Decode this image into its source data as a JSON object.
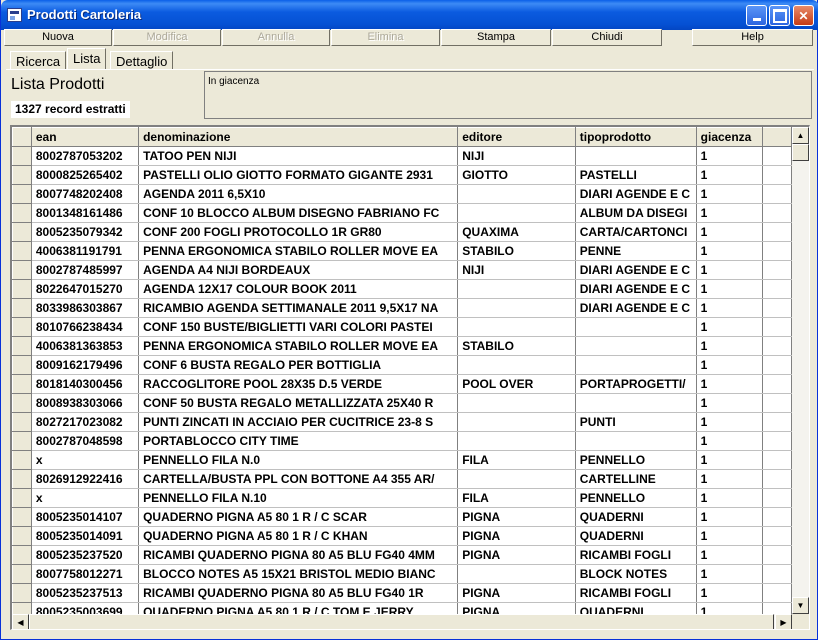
{
  "window": {
    "title": "Prodotti Cartoleria"
  },
  "toolbar": {
    "buttons": [
      {
        "label": "Nuova",
        "enabled": true
      },
      {
        "label": "Modifica",
        "enabled": false
      },
      {
        "label": "Annulla",
        "enabled": false
      },
      {
        "label": "Elimina",
        "enabled": false
      },
      {
        "label": "Stampa",
        "enabled": true
      },
      {
        "label": "Chiudi",
        "enabled": true
      },
      {
        "label": "Help",
        "enabled": true
      }
    ]
  },
  "tabs": [
    {
      "label": "Ricerca",
      "active": false
    },
    {
      "label": "Lista",
      "active": true
    },
    {
      "label": "Dettaglio",
      "active": false
    }
  ],
  "panel": {
    "title": "Lista Prodotti",
    "record_count": "1327 record estratti",
    "filter_text": "In giacenza"
  },
  "grid": {
    "columns": [
      "ean",
      "denominazione",
      "editore",
      "tipoprodotto",
      "giacenza"
    ],
    "rows": [
      [
        "8002787053202",
        "TATOO PEN NIJI",
        "NIJI",
        "",
        "1"
      ],
      [
        "8000825265402",
        "PASTELLI OLIO GIOTTO FORMATO GIGANTE 2931",
        "GIOTTO",
        "PASTELLI",
        "1"
      ],
      [
        "8007748202408",
        "AGENDA 2011 6,5X10",
        "",
        "DIARI AGENDE E C",
        "1"
      ],
      [
        "8001348161486",
        "CONF 10 BLOCCO ALBUM DISEGNO FABRIANO FC",
        "",
        "ALBUM DA DISEGI",
        "1"
      ],
      [
        "8005235079342",
        "CONF 200 FOGLI PROTOCOLLO 1R GR80",
        "QUAXIMA",
        "CARTA/CARTONCI",
        "1"
      ],
      [
        "4006381191791",
        "PENNA ERGONOMICA STABILO ROLLER MOVE EA",
        "STABILO",
        "PENNE",
        "1"
      ],
      [
        "8002787485997",
        "AGENDA A4 NIJI BORDEAUX",
        "NIJI",
        "DIARI AGENDE E C",
        "1"
      ],
      [
        "8022647015270",
        "AGENDA 12X17 COLOUR BOOK 2011",
        "",
        "DIARI AGENDE E C",
        "1"
      ],
      [
        "8033986303867",
        "RICAMBIO AGENDA SETTIMANALE 2011 9,5X17 NA",
        "",
        "DIARI AGENDE E C",
        "1"
      ],
      [
        "8010766238434",
        "CONF 150 BUSTE/BIGLIETTI VARI COLORI PASTEI",
        "",
        "",
        "1"
      ],
      [
        "4006381363853",
        "PENNA ERGONOMICA STABILO ROLLER MOVE EA",
        "STABILO",
        "",
        "1"
      ],
      [
        "8009162179496",
        "CONF 6 BUSTA REGALO PER BOTTIGLIA",
        "",
        "",
        "1"
      ],
      [
        "8018140300456",
        "RACCOGLITORE POOL 28X35 D.5 VERDE",
        "POOL OVER",
        "PORTAPROGETTI/",
        "1"
      ],
      [
        "8008938303066",
        "CONF 50 BUSTA REGALO METALLIZZATA 25X40 R",
        "",
        "",
        "1"
      ],
      [
        "8027217023082",
        "PUNTI ZINCATI IN ACCIAIO PER CUCITRICE 23-8 S",
        "",
        "PUNTI",
        "1"
      ],
      [
        "8002787048598",
        "PORTABLOCCO CITY TIME",
        "",
        "",
        "1"
      ],
      [
        "x",
        "PENNELLO FILA N.0",
        "FILA",
        "PENNELLO",
        "1"
      ],
      [
        "8026912922416",
        "CARTELLA/BUSTA PPL CON BOTTONE A4 355 AR/",
        "",
        "CARTELLINE",
        "1"
      ],
      [
        "x",
        "PENNELLO FILA N.10",
        "FILA",
        "PENNELLO",
        "1"
      ],
      [
        "8005235014107",
        "QUADERNO PIGNA A5 80 1 R / C SCAR",
        "PIGNA",
        "QUADERNI",
        "1"
      ],
      [
        "8005235014091",
        "QUADERNO PIGNA A5 80 1 R / C KHAN",
        "PIGNA",
        "QUADERNI",
        "1"
      ],
      [
        "8005235237520",
        "RICAMBI QUADERNO PIGNA 80 A5 BLU FG40 4MM",
        "PIGNA",
        "RICAMBI FOGLI",
        "1"
      ],
      [
        "8007758012271",
        "BLOCCO NOTES A5 15X21 BRISTOL MEDIO BIANC",
        "",
        "BLOCK NOTES",
        "1"
      ],
      [
        "8005235237513",
        "RICAMBI QUADERNO PIGNA 80 A5 BLU FG40 1R",
        "PIGNA",
        "RICAMBI FOGLI",
        "1"
      ],
      [
        "8005235003699",
        "QUADERNO PIGNA A5 80 1 R / C TOM E JERRY",
        "PIGNA",
        "QUADERNI",
        "1"
      ]
    ]
  }
}
